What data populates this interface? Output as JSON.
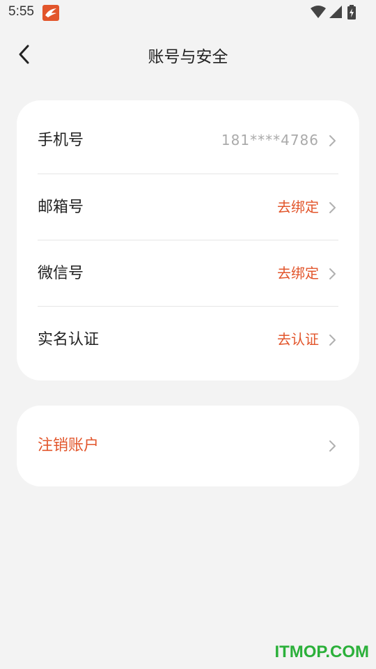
{
  "status_bar": {
    "time": "5:55"
  },
  "header": {
    "title": "账号与安全"
  },
  "account_rows": [
    {
      "label": "手机号",
      "value": "181****4786"
    },
    {
      "label": "邮箱号",
      "value": "去绑定"
    },
    {
      "label": "微信号",
      "value": "去绑定"
    },
    {
      "label": "实名认证",
      "value": "去认证"
    }
  ],
  "cancel_account": {
    "label": "注销账户"
  },
  "watermark": "ITMOP.COM",
  "colors": {
    "accent": "#e2552b",
    "muted": "#aaaaaa",
    "background": "#f3f3f3",
    "card": "#ffffff"
  }
}
